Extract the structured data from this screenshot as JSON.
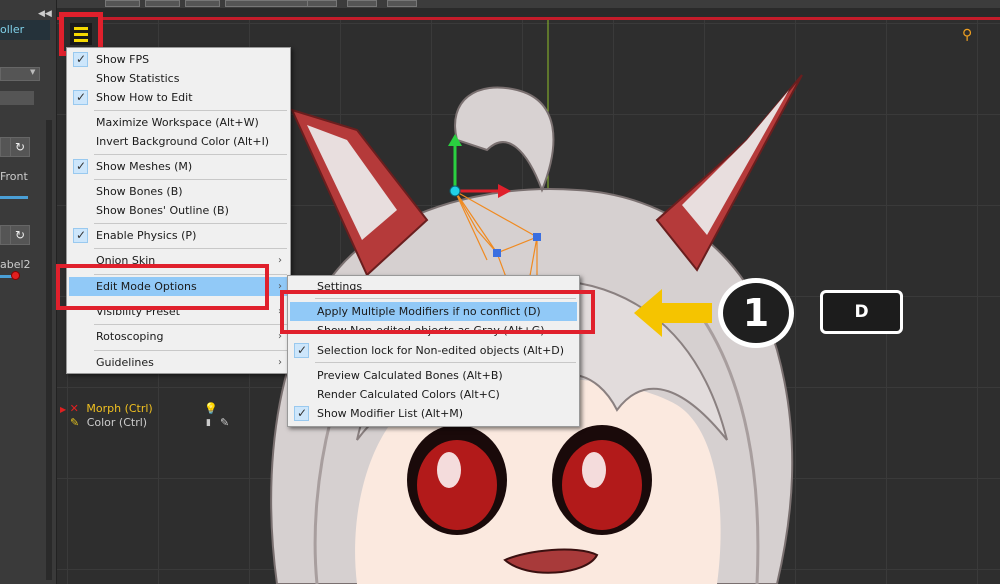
{
  "left_panel": {
    "collapse": "◀◀",
    "tab_label": "oller",
    "front_label": "Front",
    "label2": "abel2"
  },
  "menu_main": [
    {
      "label": "Show FPS",
      "checked": true
    },
    {
      "label": "Show Statistics",
      "checked": false
    },
    {
      "label": "Show How to Edit",
      "checked": true
    },
    {
      "label": "Maximize Workspace (Alt+W)",
      "checked": false
    },
    {
      "label": "Invert Background Color (Alt+I)",
      "checked": false
    },
    {
      "label": "Show Meshes (M)",
      "checked": true
    },
    {
      "label": "Show Bones (B)",
      "checked": false
    },
    {
      "label": "Show Bones' Outline (B)",
      "checked": false
    },
    {
      "label": "Enable Physics (P)",
      "checked": true
    },
    {
      "label": "Onion Skin",
      "submenu": true
    },
    {
      "label": "Edit Mode Options",
      "submenu": true,
      "highlighted": true
    },
    {
      "label": "Visibility Preset",
      "submenu": true
    },
    {
      "label": "Rotoscoping",
      "submenu": true
    },
    {
      "label": "Guidelines",
      "submenu": true
    }
  ],
  "menu_sub": [
    {
      "label": "Settings",
      "checked": false
    },
    {
      "label": "Apply Multiple Modifiers if no conflict (D)",
      "checked": false,
      "highlighted": true
    },
    {
      "label": "Show Non-edited objects as Gray (Alt+G)",
      "checked": false
    },
    {
      "label": "Selection lock for Non-edited objects (Alt+D)",
      "checked": true
    },
    {
      "label": "Preview Calculated Bones (Alt+B)",
      "checked": false
    },
    {
      "label": "Render Calculated Colors (Alt+C)",
      "checked": false
    },
    {
      "label": "Show Modifier List (Alt+M)",
      "checked": true
    }
  ],
  "timeline": {
    "morph_label": "Morph (Ctrl)",
    "color_label": "Color (Ctrl)"
  },
  "annotation": {
    "step_number": "1",
    "key": "D"
  },
  "colors": {
    "highlight_red": "#e0202c",
    "menu_highlight": "#91c9f7",
    "arrow_yellow": "#f5c400"
  }
}
